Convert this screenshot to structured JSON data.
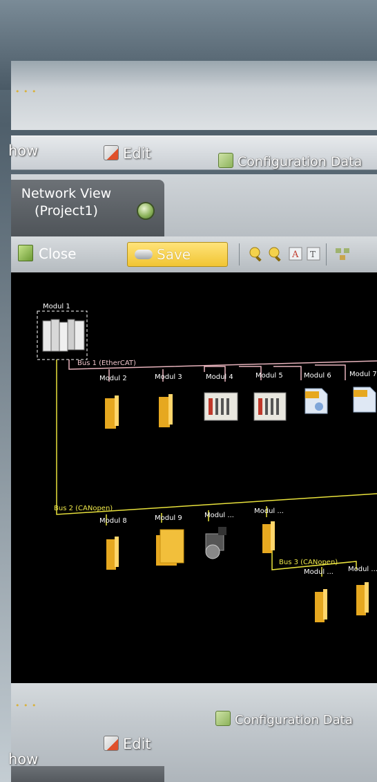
{
  "menu": {
    "show_label": "how",
    "edit_label": "Edit",
    "config_label": "Configuration Data"
  },
  "tab": {
    "title_line1": "Network View",
    "title_line2": "(Project1)"
  },
  "toolbar": {
    "close_label": "Close",
    "save_label": "Save"
  },
  "network": {
    "root_label": "Modul 1",
    "buses": [
      {
        "label": "Bus 1 (EtherCAT)",
        "color": "#e8b4bd"
      },
      {
        "label": "Bus 2 (CANopen)",
        "color": "#e9e23c"
      },
      {
        "label": "Bus 3 (CANopen)",
        "color": "#e9e23c"
      }
    ],
    "bus1_modules": [
      "Modul 2",
      "Modul 3",
      "Modul 4",
      "Modul 5",
      "Modul 6",
      "Modul 7"
    ],
    "bus2_modules": [
      "Modul 8",
      "Modul 9",
      "Modul ...",
      "Modul ..."
    ],
    "bus3_modules": [
      "Modul ...",
      "Modul ..."
    ]
  },
  "bottom_menu": {
    "show_label": "how",
    "edit_label": "Edit",
    "config_label": "Configuration Data"
  },
  "colors": {
    "accent": "#f1c533",
    "canvas": "#000000",
    "drive": "#e6a820"
  }
}
